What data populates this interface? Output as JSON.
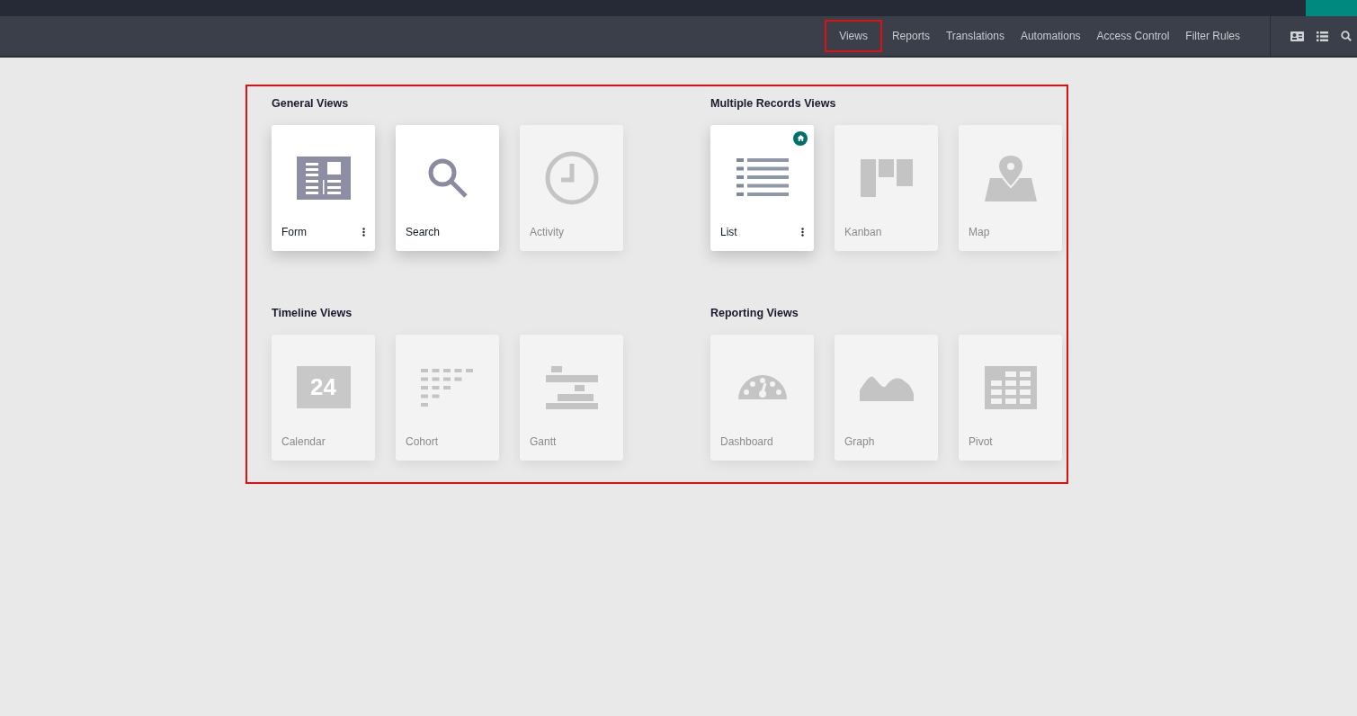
{
  "nav": {
    "items": [
      {
        "label": "Views",
        "highlighted": true
      },
      {
        "label": "Reports",
        "highlighted": false
      },
      {
        "label": "Translations",
        "highlighted": false
      },
      {
        "label": "Automations",
        "highlighted": false
      },
      {
        "label": "Access Control",
        "highlighted": false
      },
      {
        "label": "Filter Rules",
        "highlighted": false
      }
    ]
  },
  "views_panel": {
    "highlighted": true,
    "sections": [
      {
        "title": "General Views",
        "cards": [
          {
            "label": "Form",
            "kind": "form",
            "active": true,
            "menu": true,
            "default": false
          },
          {
            "label": "Search",
            "kind": "search",
            "active": true,
            "menu": false,
            "default": false
          },
          {
            "label": "Activity",
            "kind": "activity",
            "active": false,
            "menu": false,
            "default": false
          }
        ]
      },
      {
        "title": "Multiple Records Views",
        "cards": [
          {
            "label": "List",
            "kind": "list",
            "active": true,
            "menu": true,
            "default": true
          },
          {
            "label": "Kanban",
            "kind": "kanban",
            "active": false,
            "menu": false,
            "default": false
          },
          {
            "label": "Map",
            "kind": "map",
            "active": false,
            "menu": false,
            "default": false
          }
        ]
      },
      {
        "title": "Timeline Views",
        "cards": [
          {
            "label": "Calendar",
            "kind": "calendar",
            "active": false,
            "menu": false,
            "default": false,
            "icon_text": "24"
          },
          {
            "label": "Cohort",
            "kind": "cohort",
            "active": false,
            "menu": false,
            "default": false
          },
          {
            "label": "Gantt",
            "kind": "gantt",
            "active": false,
            "menu": false,
            "default": false
          }
        ]
      },
      {
        "title": "Reporting Views",
        "cards": [
          {
            "label": "Dashboard",
            "kind": "dashboard",
            "active": false,
            "menu": false,
            "default": false
          },
          {
            "label": "Graph",
            "kind": "graph",
            "active": false,
            "menu": false,
            "default": false
          },
          {
            "label": "Pivot",
            "kind": "pivot",
            "active": false,
            "menu": false,
            "default": false
          }
        ]
      }
    ]
  }
}
